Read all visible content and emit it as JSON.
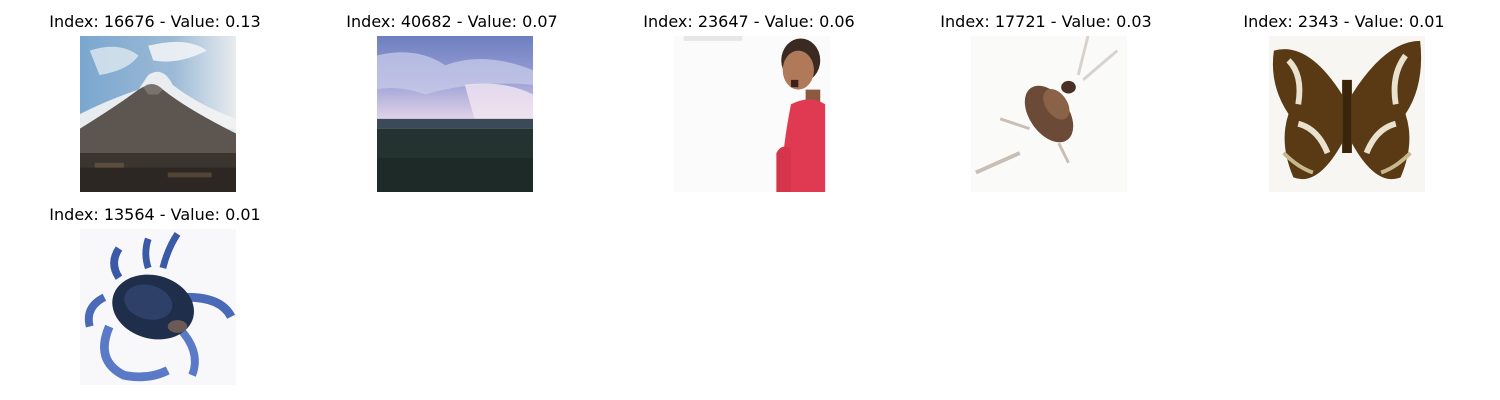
{
  "panels": [
    {
      "title": "Index: 16676 - Value: 0.13",
      "image_subject": "mountain under cloudy sky"
    },
    {
      "title": "Index: 40682 - Value: 0.07",
      "image_subject": "cloudy sky over dark field"
    },
    {
      "title": "Index: 23647 - Value: 0.06",
      "image_subject": "person in red shirt"
    },
    {
      "title": "Index: 17721 - Value: 0.03",
      "image_subject": "cockroach on white background"
    },
    {
      "title": "Index: 2343 - Value: 0.01",
      "image_subject": "brown butterfly"
    },
    {
      "title": "Index: 13564 - Value: 0.01",
      "image_subject": "blue crab"
    }
  ]
}
